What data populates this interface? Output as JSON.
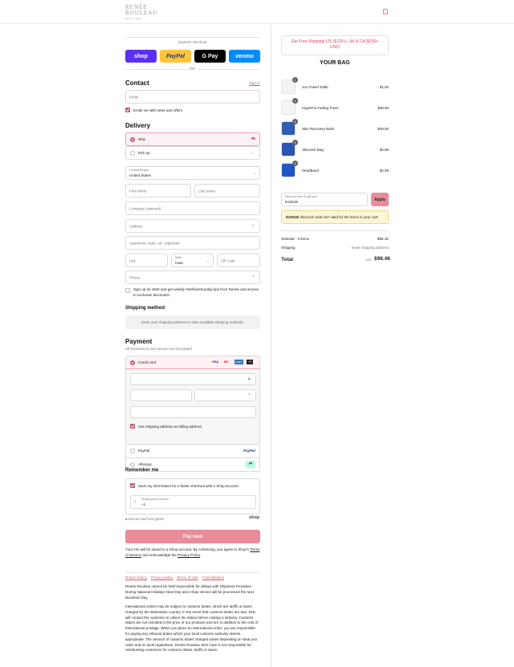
{
  "header": {
    "logo_line1": "RENÉE",
    "logo_line2": "ROULEAU",
    "logo_tag": "SKIN CARE",
    "cart_icon": "bag-icon"
  },
  "express": {
    "title": "Express checkout",
    "or": "OR",
    "buttons": [
      {
        "label": "shop",
        "color": "#5a31f4"
      },
      {
        "label": "PayPal",
        "color": "#ffc439"
      },
      {
        "label": "G Pay",
        "color": "#000000"
      },
      {
        "label": "venmo",
        "color": "#008cff"
      }
    ]
  },
  "contact": {
    "title": "Contact",
    "sign_in": "Sign in",
    "email_placeholder": "Email",
    "news_label": "Email me with news and offers"
  },
  "delivery": {
    "title": "Delivery",
    "ship": "Ship",
    "pickup": "Pick up",
    "country_label": "Country/Region",
    "country_value": "United States",
    "first": "First name",
    "last": "Last name",
    "company": "Company (optional)",
    "address": "Address",
    "apt": "Apartment, suite, etc. (optional)",
    "city": "City",
    "state_label": "State",
    "state_value": "Iowa",
    "zip": "ZIP code",
    "phone": "Phone",
    "sms": "Sign up for SMS and get weekly #selfcareSunday tips from Renée and access to exclusive discounts!"
  },
  "shipping": {
    "title": "Shipping method",
    "note": "Enter your shipping address to view available shipping methods."
  },
  "payment": {
    "title": "Payment",
    "subtitle": "All transactions are secure and encrypted.",
    "credit": "Credit card",
    "billing": "Use shipping address as billing address",
    "paypal": "PayPal",
    "afterpay": "Afterpay",
    "cards": [
      "VISA",
      "MC",
      "AMEX",
      "+3"
    ]
  },
  "remember": {
    "title": "Remember me",
    "save": "Save my information for a faster checkout with a Shop account",
    "mobile_label": "Mobile phone number",
    "mobile_value": "+1",
    "secure": "Secure and encrypted",
    "shop": "shop"
  },
  "paynow": {
    "label": "Pay now",
    "color": "#e88c9a",
    "note1": "Your info will be saved to a Shop account. By continuing, you agree to Shop's",
    "terms": "Terms of Service",
    "and": "and acknowledge the",
    "privacy": "Privacy Policy"
  },
  "footer": {
    "links": [
      "Return Policy",
      "Privacy policy",
      "Terms of Use",
      "Cancellations"
    ],
    "p1": "Renée Rouleau cannot be held responsible for delays with Shipment Providers. During National Holidays Next Day and 2-Day service will be processed the next Business Day.",
    "p2": "International orders may be subject to customs duties, which are tariffs or taxes charged by the destination country. In the event that customs duties are due, DHL will contact the customer to collect the duties before making a delivery. Customs duties are not included in the price of our products and are in addition to the cost of international postage. When you place an international order, you are responsible for paying any inbound duties which your local customs authority deems appropriate. The amount of customs duties charged varies depending on what you order and on local regulations. Renée Rouleau Skin Care is not responsible for reimbursing customers for customs duties, tariffs or taxes."
  },
  "bag": {
    "promo": "Get Free Shipping! US ($125+), UK & CA ($150+ USD)",
    "title": "YOUR BAG",
    "items": [
      {
        "name": "2oz Travel Tottle",
        "price": "$1.50",
        "qty": "1",
        "color": "#f2f2f2"
      },
      {
        "name": "HyperFix Fading Toner",
        "price": "$39.50",
        "qty": "1",
        "color": "#f4f4f4"
      },
      {
        "name": "Skin Recovery Balm",
        "price": "$49.50",
        "qty": "1",
        "color": "#2f5fb3"
      },
      {
        "name": "Skincare Bag",
        "price": "$2.98",
        "qty": "1",
        "color": "#2a55b0"
      },
      {
        "name": "Headband",
        "price": "$2.98",
        "qty": "1",
        "color": "#1f57c9"
      }
    ],
    "discount_label": "Discount code or gift card",
    "discount_value": "D4251E",
    "apply": "Apply",
    "warn_code": "D4251E",
    "warn_text": "discount code isn't valid for the items in your cart",
    "subtotal_label": "Subtotal · 5 items",
    "subtotal": "$96.46",
    "shipping_label": "Shipping",
    "shipping_value": "Enter shipping address",
    "total_label": "Total",
    "currency": "USD",
    "total": "$96.46"
  }
}
